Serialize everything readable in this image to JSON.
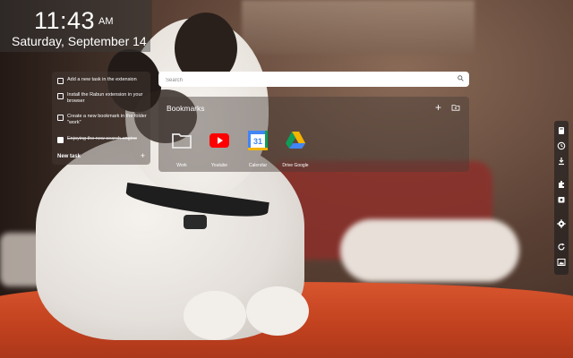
{
  "clock": {
    "time": "11:43",
    "ampm": "AM",
    "date": "Saturday, September 14"
  },
  "tasks": {
    "items": [
      {
        "text": "Add a new task in the extension",
        "done": false
      },
      {
        "text": "Install the Rabun extension in your browser",
        "done": false
      },
      {
        "text": "Create a new bookmark in the folder \"work\"",
        "done": false
      },
      {
        "text": "Enjoying the new search engine",
        "done": true
      }
    ],
    "new_task_label": "New task",
    "add_symbol": "+"
  },
  "search": {
    "placeholder": "Search",
    "icon": "search-icon"
  },
  "bookmarks": {
    "title": "Bookmarks",
    "add_symbol": "+",
    "items": [
      {
        "label": "Work",
        "icon": "folder-icon"
      },
      {
        "label": "Youtube",
        "icon": "youtube-icon"
      },
      {
        "label": "Calendar",
        "icon": "calendar-icon",
        "badge": "31"
      },
      {
        "label": "Drive Google",
        "icon": "drive-icon"
      }
    ]
  },
  "sidebar": {
    "icons": [
      "bookmark-icon",
      "history-icon",
      "download-icon",
      "extension-icon",
      "screenshot-icon",
      "settings-icon",
      "refresh-icon",
      "wallpaper-icon"
    ]
  },
  "colors": {
    "youtube": "#ff0000",
    "calendar_blue": "#4285f4",
    "drive_green": "#0f9d58",
    "drive_yellow": "#f4b400"
  }
}
